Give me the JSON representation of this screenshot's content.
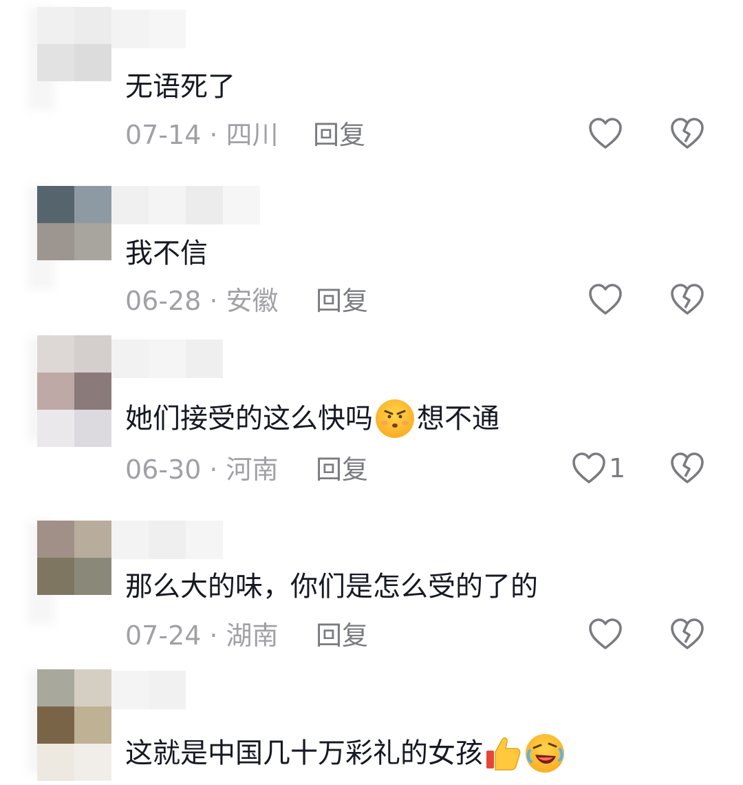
{
  "comments": [
    {
      "text": "无语死了",
      "date": "07-14",
      "location": "四川",
      "reply_label": "回复",
      "like_count": ""
    },
    {
      "text": "我不信",
      "date": "06-28",
      "location": "安徽",
      "reply_label": "回复",
      "like_count": ""
    },
    {
      "text_before": "她们接受的这么快吗",
      "text_after": "想不通",
      "emoji": "frown-emoji-icon",
      "date": "06-30",
      "location": "河南",
      "reply_label": "回复",
      "like_count": "1"
    },
    {
      "text": "那么大的味，你们是怎么受的了的",
      "date": "07-24",
      "location": "湖南",
      "reply_label": "回复",
      "like_count": ""
    },
    {
      "text": "这就是中国几十万彩礼的女孩",
      "emojis": [
        "thumbs-up-icon",
        "rofl-emoji-icon"
      ]
    }
  ],
  "colors": {
    "text": "#161823",
    "meta": "#a0a0a6",
    "action": "#7a7b80"
  }
}
